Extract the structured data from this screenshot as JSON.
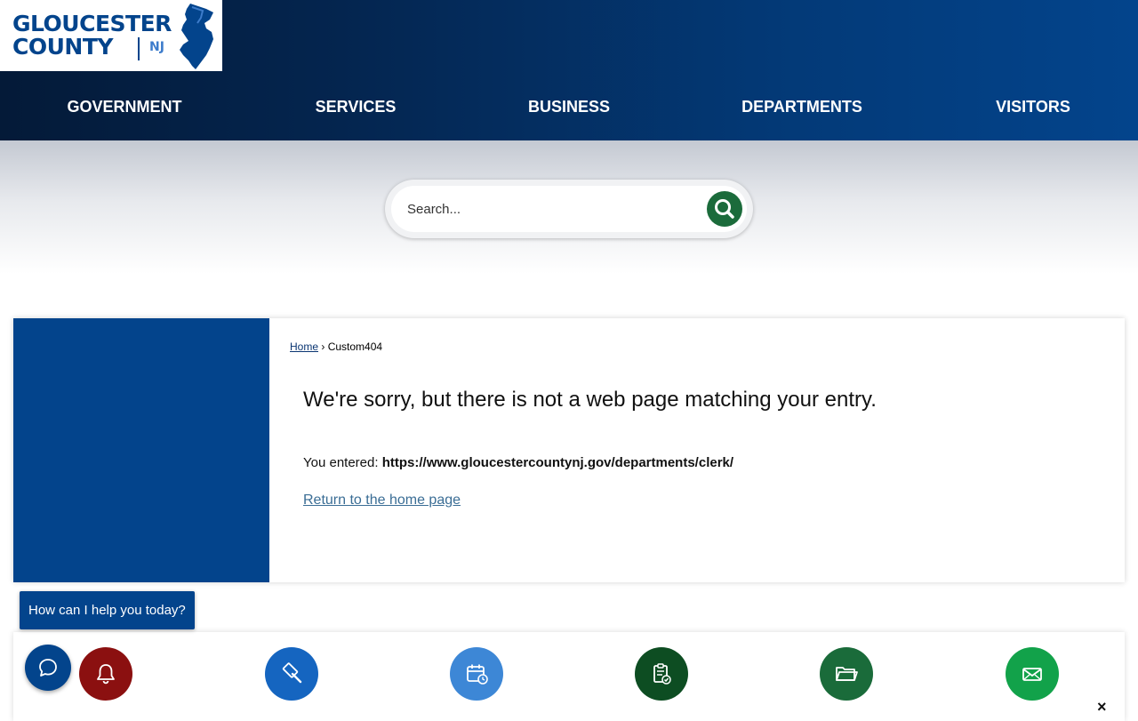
{
  "brand": {
    "line1": "GLOUCESTER",
    "line2": "COUNTY",
    "state": "NJ"
  },
  "nav": [
    {
      "label": "GOVERNMENT"
    },
    {
      "label": "SERVICES"
    },
    {
      "label": "BUSINESS"
    },
    {
      "label": "DEPARTMENTS"
    },
    {
      "label": "VISITORS"
    }
  ],
  "search": {
    "placeholder": "Search..."
  },
  "breadcrumb": {
    "home": "Home",
    "separator": "›",
    "current": "Custom404"
  },
  "error": {
    "title": "We're sorry, but there is not a web page matching your entry.",
    "entered_label": "You entered:",
    "entered_url": "https://www.gloucestercountynj.gov/departments/clerk/",
    "return_link": "Return to the home page"
  },
  "chat": {
    "prompt": "How can I help you today?"
  },
  "quick_links": [
    {
      "icon": "bell-icon",
      "color": "#8b1010"
    },
    {
      "icon": "gavel-icon",
      "color": "#1565c0"
    },
    {
      "icon": "calendar-icon",
      "color": "#3d87d6"
    },
    {
      "icon": "clipboard-check-icon",
      "color": "#0d4d22"
    },
    {
      "icon": "folder-icon",
      "color": "#1a6b3a"
    },
    {
      "icon": "mail-icon",
      "color": "#12a24a"
    }
  ],
  "colors": {
    "brand_blue": "#03448c",
    "search_green": "#1b6b3b"
  },
  "close": "×"
}
